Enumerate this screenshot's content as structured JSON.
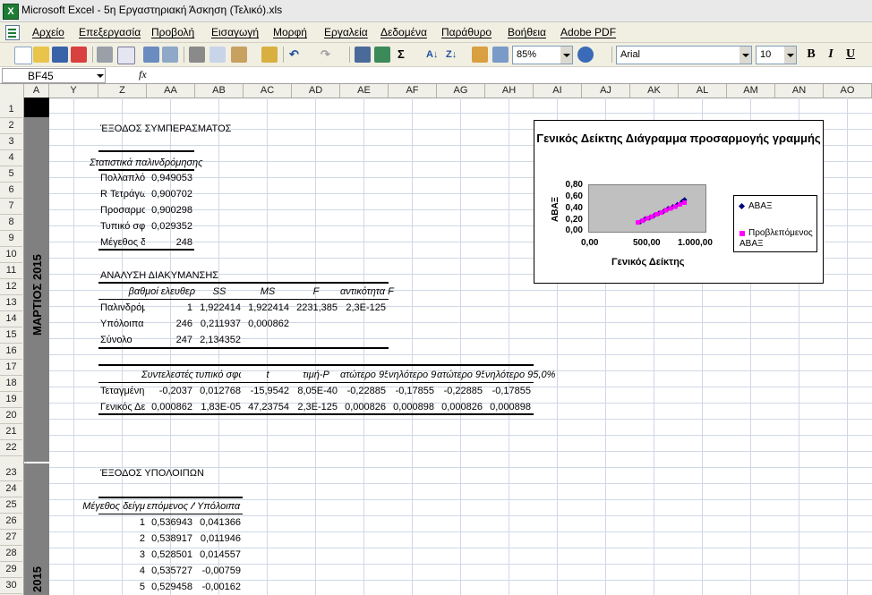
{
  "window": {
    "title": "Microsoft Excel - 5η Εργαστηριακή Άσκηση (Τελικό).xls",
    "app_icon": "X"
  },
  "menu": [
    "Αρχείο",
    "Επεξεργασία",
    "Προβολή",
    "Εισαγωγή",
    "Μορφή",
    "Εργαλεία",
    "Δεδομένα",
    "Παράθυρο",
    "Βοήθεια",
    "Adobe PDF"
  ],
  "toolbar": {
    "zoom": "85%",
    "font": "Arial",
    "size": "10",
    "bold": "B",
    "italic": "I",
    "underline": "U"
  },
  "formula": {
    "namebox": "BF45",
    "fx": "fx"
  },
  "columns": [
    "A",
    "Y",
    "Z",
    "AA",
    "AB",
    "AC",
    "AD",
    "AE",
    "AF",
    "AG",
    "AH",
    "AI",
    "AJ",
    "AK",
    "AL",
    "AM",
    "AN",
    "AO"
  ],
  "rows": [
    "1",
    "2",
    "3",
    "4",
    "5",
    "6",
    "7",
    "8",
    "9",
    "10",
    "11",
    "12",
    "13",
    "14",
    "15",
    "16",
    "17",
    "18",
    "19",
    "20",
    "21",
    "22",
    "23",
    "24",
    "25",
    "26",
    "27",
    "28",
    "29",
    "30"
  ],
  "month_labels": [
    "ΜΑΡΤΙΟΣ 2015",
    "2015"
  ],
  "summary": {
    "title": "ΈΞΟΔΟΣ ΣΥΜΠΕΡΑΣΜΑΤΟΣ",
    "regression_header": "Στατιστικά παλινδρόμησης",
    "stats": [
      {
        "label": "Πολλαπλό",
        "value": "0,949053"
      },
      {
        "label": "R Τετράγω",
        "value": "0,900702"
      },
      {
        "label": "Προσαρμο",
        "value": "0,900298"
      },
      {
        "label": "Τυπικό σφ",
        "value": "0,029352"
      },
      {
        "label": "Μέγεθος δ",
        "value": "248"
      }
    ],
    "anova_title": "ΑΝΑΛΥΣΗ ΔΙΑΚΥΜΑΝΣΗΣ",
    "anova_headers": [
      "βαθμοί ελευθερ",
      "SS",
      "MS",
      "F",
      "αντικότητα F"
    ],
    "anova_rows": [
      [
        "Παλινδρόμ",
        "1",
        "1,922414",
        "1,922414",
        "2231,385",
        "2,3E-125"
      ],
      [
        "Υπόλοιπα",
        "246",
        "0,211937",
        "0,000862",
        "",
        ""
      ],
      [
        "Σύνολο",
        "247",
        "2,134352",
        "",
        "",
        ""
      ]
    ],
    "coef_headers": [
      "Συντελεστές",
      "τυπικό σφάλ",
      "t",
      "τιμή-P",
      "ατώτερο 95",
      "νηλότερο 95",
      "ατώτερο 95,0",
      "νηλότερο 95,0%"
    ],
    "coef_rows": [
      [
        "Τεταγμένη",
        "-0,2037",
        "0,012768",
        "-15,9542",
        "8,05E-40",
        "-0,22885",
        "-0,17855",
        "-0,22885",
        "-0,17855"
      ],
      [
        "Γενικός Δε",
        "0,000862",
        "1,83E-05",
        "47,23754",
        "2,3E-125",
        "0,000826",
        "0,000898",
        "0,000826",
        "0,000898"
      ]
    ],
    "residual_title": "ΈΞΟΔΟΣ ΥΠΟΛΟΙΠΩΝ",
    "residual_headers": [
      "Μέγεθος δείγμ",
      "επόμενος Λ",
      "Υπόλοιπα"
    ],
    "residual_rows": [
      [
        "1",
        "0,536943",
        "0,041366"
      ],
      [
        "2",
        "0,538917",
        "0,011946"
      ],
      [
        "3",
        "0,528501",
        "0,014557"
      ],
      [
        "4",
        "0,535727",
        "-0,00759"
      ],
      [
        "5",
        "0,529458",
        "-0,00162"
      ]
    ]
  },
  "chart_data": {
    "type": "scatter",
    "title": "Γενικός Δείκτης Διάγραμμα προσαρμογής γραμμής",
    "xlabel": "Γενικός Δείκτης",
    "ylabel": "ΑΒΑΞ",
    "xlim": [
      0,
      1000
    ],
    "ylim": [
      0,
      0.8
    ],
    "xticks": [
      "0,00",
      "500,00",
      "1.000,00"
    ],
    "yticks": [
      "0,80",
      "0,60",
      "0,40",
      "0,20",
      "0,00"
    ],
    "legend_position": "right",
    "series": [
      {
        "name": "ΑΒΑΞ",
        "color": "#000080",
        "x": [
          440,
          480,
          520,
          560,
          600,
          640,
          680,
          720,
          760,
          800,
          820
        ],
        "y": [
          0.17,
          0.22,
          0.24,
          0.28,
          0.32,
          0.35,
          0.4,
          0.43,
          0.47,
          0.52,
          0.55
        ]
      },
      {
        "name": "Προβλεπόμενος ΑΒΑΞ",
        "color": "#ff00ff",
        "x": [
          420,
          460,
          500,
          540,
          580,
          620,
          660,
          700,
          740,
          780,
          820
        ],
        "y": [
          0.16,
          0.19,
          0.23,
          0.26,
          0.3,
          0.33,
          0.37,
          0.4,
          0.43,
          0.47,
          0.5
        ]
      }
    ]
  }
}
